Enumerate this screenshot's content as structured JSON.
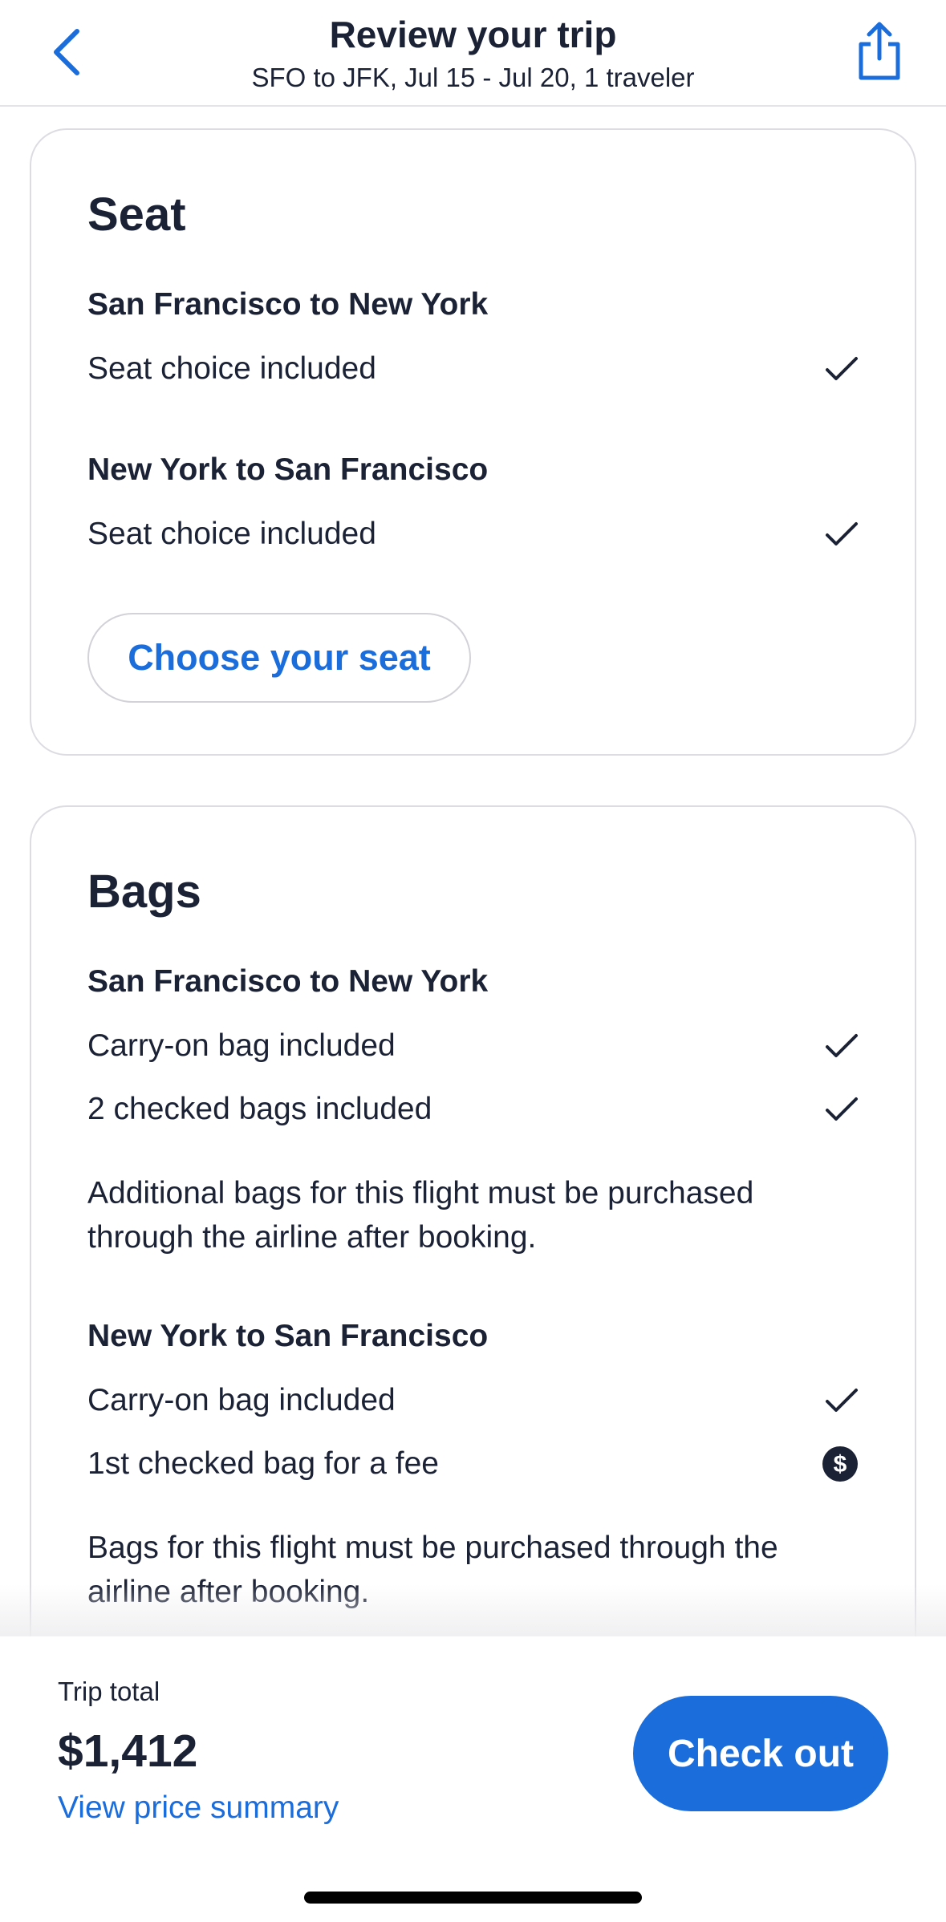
{
  "header": {
    "title": "Review your trip",
    "subtitle": "SFO to JFK, Jul 15 - Jul 20, 1 traveler",
    "back_icon": "chevron-left-icon",
    "share_icon": "share-icon"
  },
  "seat": {
    "title": "Seat",
    "outbound": {
      "route": "San Francisco to New York",
      "items": [
        {
          "label": "Seat choice included",
          "icon": "checkmark-icon"
        }
      ]
    },
    "return": {
      "route": "New York to San Francisco",
      "items": [
        {
          "label": "Seat choice included",
          "icon": "checkmark-icon"
        }
      ]
    },
    "choose_label": "Choose your seat"
  },
  "bags": {
    "title": "Bags",
    "outbound": {
      "route": "San Francisco to New York",
      "items": [
        {
          "label": "Carry-on bag included",
          "icon": "checkmark-icon"
        },
        {
          "label": "2 checked bags included",
          "icon": "checkmark-icon"
        }
      ],
      "note": "Additional bags for this flight must be purchased through the airline after booking."
    },
    "return": {
      "route": "New York to San Francisco",
      "items": [
        {
          "label": "Carry-on bag included",
          "icon": "checkmark-icon"
        },
        {
          "label": "1st checked bag for a fee",
          "icon": "dollar-fee-icon"
        }
      ],
      "note": "Bags for this flight must be purchased through the airline after booking."
    }
  },
  "footer": {
    "trip_total_label": "Trip total",
    "trip_total_value": "$1,412",
    "price_summary_link": "View price summary",
    "checkout_label": "Check out"
  },
  "colors": {
    "accent": "#1a6ddb",
    "text": "#1c2236",
    "border": "#dcdce2"
  }
}
